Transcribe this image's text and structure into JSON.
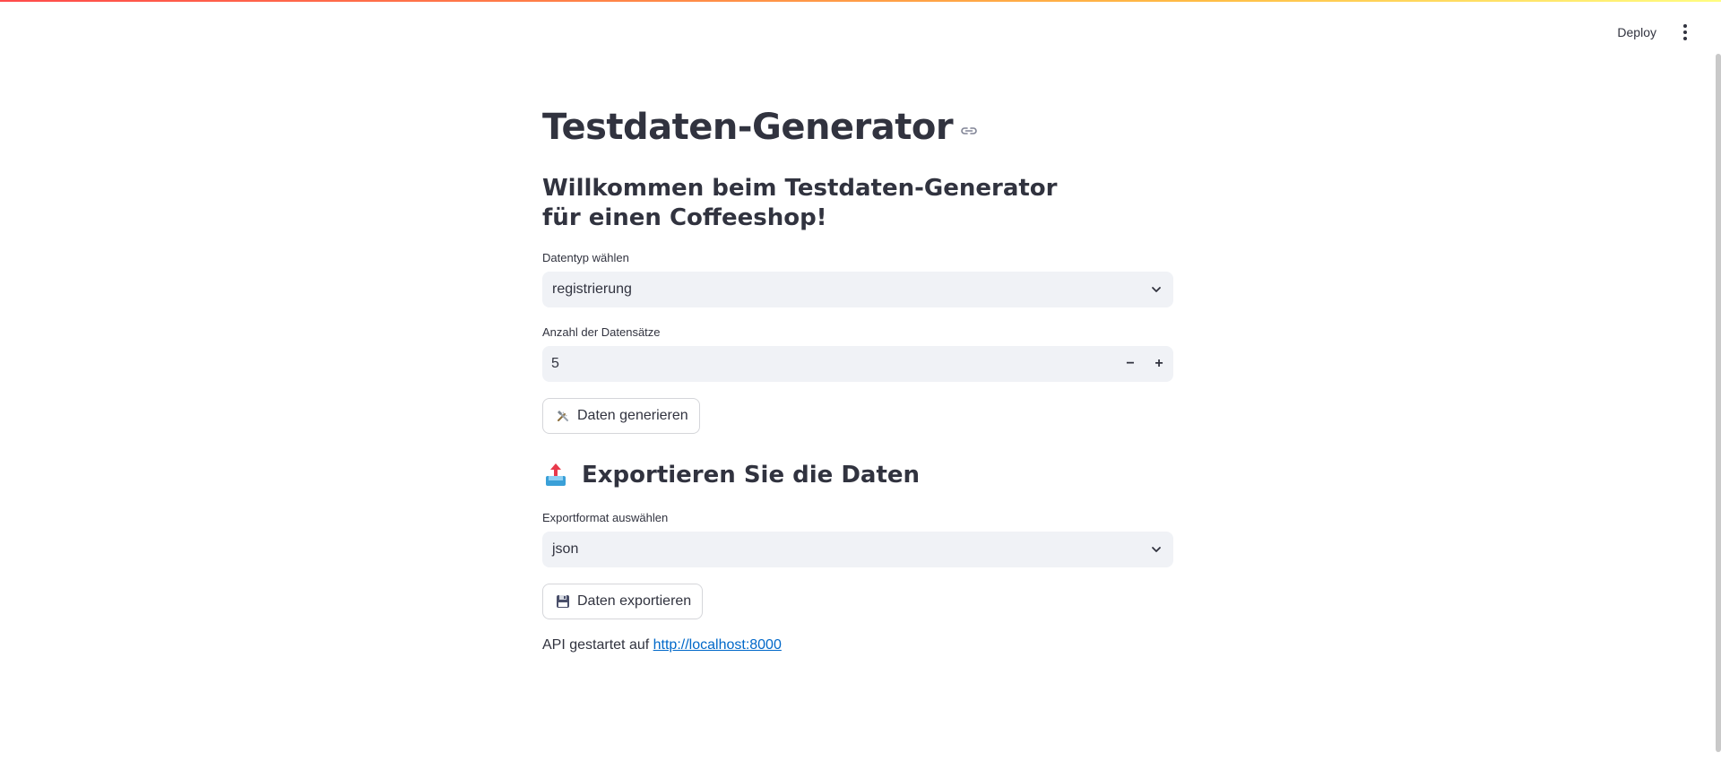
{
  "header": {
    "deploy_label": "Deploy",
    "menu_icon": "vertical-dots-icon"
  },
  "main": {
    "title": "Testdaten-Generator",
    "subtitle": "Willkommen beim Testdaten-Generator für einen Coffeeshop!",
    "datatype": {
      "label": "Datentyp wählen",
      "value": "registrierung"
    },
    "count": {
      "label": "Anzahl der Datensätze",
      "value": "5",
      "minus": "−",
      "plus": "+"
    },
    "generate_button": {
      "icon": "tools-icon",
      "label": "Daten generieren"
    },
    "export_section": {
      "icon": "outbox-tray-icon",
      "heading": "Exportieren Sie die Daten"
    },
    "export_format": {
      "label": "Exportformat auswählen",
      "value": "json"
    },
    "export_button": {
      "icon": "floppy-disk-icon",
      "label": "Daten exportieren"
    },
    "api": {
      "prefix": "API gestartet auf",
      "link": "http://localhost:8000"
    }
  },
  "colors": {
    "accent_gradient_start": "#ff4b4b",
    "accent_gradient_end": "#fffd80",
    "input_bg": "#f0f2f6",
    "text": "#31333f",
    "link": "#0068c9"
  }
}
